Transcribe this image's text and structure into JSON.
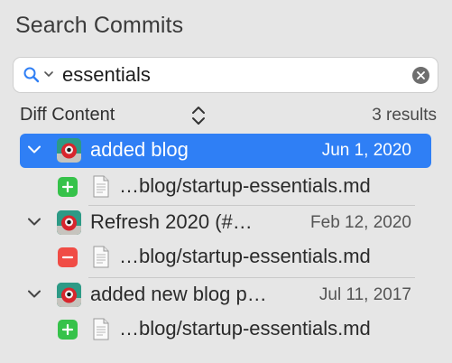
{
  "panel": {
    "title": "Search Commits"
  },
  "search": {
    "query": "essentials",
    "icon": "magnifying-glass",
    "accent": "#2f7ff5"
  },
  "filter": {
    "mode_label": "Diff Content",
    "results_text": "3 results"
  },
  "commits": [
    {
      "message": "added blog",
      "date": "Jun 1, 2020",
      "selected": true,
      "file": {
        "path": "…blog/startup-essentials.md",
        "change": "added",
        "badge_color": "#36c24a"
      }
    },
    {
      "message": "Refresh 2020 (#…",
      "date": "Feb 12, 2020",
      "selected": false,
      "file": {
        "path": "…blog/startup-essentials.md",
        "change": "removed",
        "badge_color": "#f04c45"
      }
    },
    {
      "message": "added new blog p…",
      "date": "Jul 11, 2017",
      "selected": false,
      "file": {
        "path": "…blog/startup-essentials.md",
        "change": "added",
        "badge_color": "#36c24a"
      }
    }
  ],
  "colors": {
    "background": "#e6e6e6",
    "selection": "#2f7ff5",
    "add": "#36c24a",
    "remove": "#f04c45"
  }
}
